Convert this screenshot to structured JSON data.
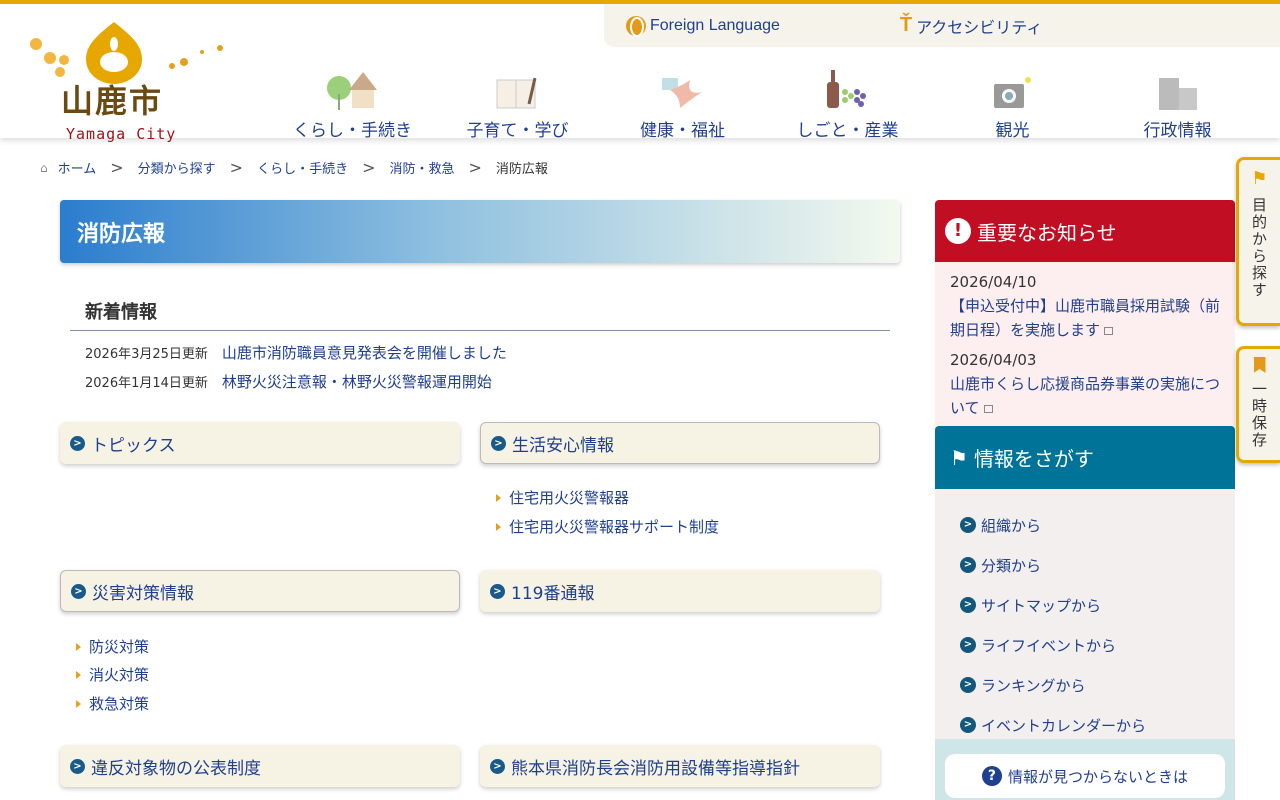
{
  "header": {
    "logo_kanji": "山鹿市",
    "logo_en": "Yamaga City",
    "foreign_language": "Foreign Language",
    "accessibility": "アクセシビリティ"
  },
  "nav": [
    {
      "label": "くらし・手続き",
      "icon": "house-tree-icon"
    },
    {
      "label": "子育て・学び",
      "icon": "notebook-icon"
    },
    {
      "label": "健康・福祉",
      "icon": "bird-letter-icon"
    },
    {
      "label": "しごと・産業",
      "icon": "bottle-grapes-icon"
    },
    {
      "label": "観光",
      "icon": "camera-icon"
    },
    {
      "label": "行政情報",
      "icon": "building-icon"
    }
  ],
  "breadcrumb": [
    "ホーム",
    "分類から探す",
    "くらし・手続き",
    "消防・救急",
    "消防広報"
  ],
  "page_title": "消防広報",
  "news": {
    "heading": "新着情報",
    "items": [
      {
        "date": "2026年3月25日更新",
        "title": "山鹿市消防職員意見発表会を開催しました"
      },
      {
        "date": "2026年1月14日更新",
        "title": "林野火災注意報・林野火災警報運用開始"
      }
    ]
  },
  "sections": [
    {
      "title": "トピックス",
      "links": []
    },
    {
      "title": "生活安心情報",
      "links": [
        "住宅用火災警報器",
        "住宅用火災警報器サポート制度"
      ]
    },
    {
      "title": "災害対策情報",
      "links": [
        "防災対策",
        "消火対策",
        "救急対策"
      ]
    },
    {
      "title": "119番通報",
      "links": []
    },
    {
      "title": "違反対象物の公表制度",
      "links": []
    },
    {
      "title": "熊本県消防長会消防用設備等指導指針",
      "links": []
    }
  ],
  "important": {
    "heading": "重要なお知らせ",
    "items": [
      {
        "date": "2026/04/10",
        "title": "【申込受付中】山鹿市職員採用試験（前期日程）を実施します"
      },
      {
        "date": "2026/04/03",
        "title": "山鹿市くらし応援商品券事業の実施について"
      }
    ]
  },
  "find": {
    "heading": "情報をさがす",
    "items": [
      "組織から",
      "分類から",
      "サイトマップから",
      "ライフイベントから",
      "ランキングから",
      "イベントカレンダーから"
    ],
    "not_found": "情報が見つからないときは"
  },
  "side_tabs": {
    "purpose": "目的から探す",
    "save": "一時保存"
  },
  "colors": {
    "accent": "#e6a800",
    "important": "#c20e22",
    "find": "#007399",
    "link": "#1f3f8f"
  }
}
